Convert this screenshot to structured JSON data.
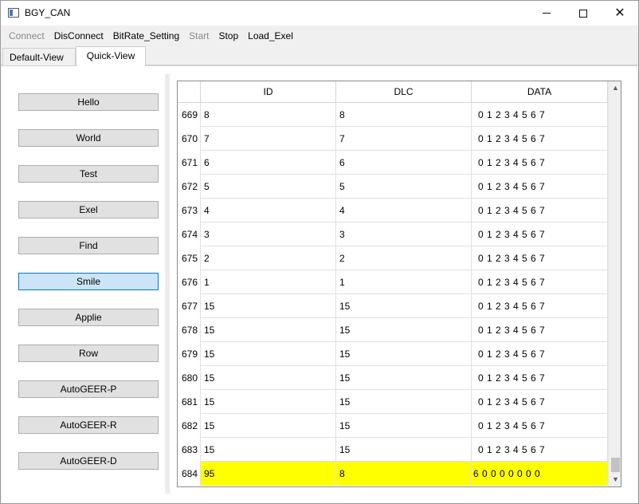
{
  "window": {
    "title": "BGY_CAN",
    "minimize_glyph": "",
    "maximize_glyph": "",
    "close_glyph": "✕"
  },
  "menu": [
    {
      "label": "Connect",
      "enabled": false
    },
    {
      "label": "DisConnect",
      "enabled": true
    },
    {
      "label": "BitRate_Setting",
      "enabled": true
    },
    {
      "label": "Start",
      "enabled": false
    },
    {
      "label": "Stop",
      "enabled": true
    },
    {
      "label": "Load_Exel",
      "enabled": true
    }
  ],
  "tabs": [
    {
      "label": "Default-View",
      "active": false
    },
    {
      "label": "Quick-View",
      "active": true
    }
  ],
  "quick_buttons": [
    {
      "label": "Hello"
    },
    {
      "label": "World"
    },
    {
      "label": "Test"
    },
    {
      "label": "Exel"
    },
    {
      "label": "Find"
    },
    {
      "label": "Smile",
      "focused": true
    },
    {
      "label": "Applie"
    },
    {
      "label": "Row"
    },
    {
      "label": "AutoGEER-P"
    },
    {
      "label": "AutoGEER-R"
    },
    {
      "label": "AutoGEER-D"
    }
  ],
  "table": {
    "headers": {
      "id": "ID",
      "dlc": "DLC",
      "data": "DATA"
    },
    "rows": [
      {
        "num": "669",
        "id": "8",
        "dlc": "8",
        "data": "0 1 2 3 4 5 6 7"
      },
      {
        "num": "670",
        "id": "7",
        "dlc": "7",
        "data": "0 1 2 3 4 5 6 7"
      },
      {
        "num": "671",
        "id": "6",
        "dlc": "6",
        "data": "0 1 2 3 4 5 6 7"
      },
      {
        "num": "672",
        "id": "5",
        "dlc": "5",
        "data": "0 1 2 3 4 5 6 7"
      },
      {
        "num": "673",
        "id": "4",
        "dlc": "4",
        "data": "0 1 2 3 4 5 6 7"
      },
      {
        "num": "674",
        "id": "3",
        "dlc": "3",
        "data": "0 1 2 3 4 5 6 7"
      },
      {
        "num": "675",
        "id": "2",
        "dlc": "2",
        "data": "0 1 2 3 4 5 6 7"
      },
      {
        "num": "676",
        "id": "1",
        "dlc": "1",
        "data": "0 1 2 3 4 5 6 7"
      },
      {
        "num": "677",
        "id": "15",
        "dlc": "15",
        "data": "0 1 2 3 4 5 6 7"
      },
      {
        "num": "678",
        "id": "15",
        "dlc": "15",
        "data": "0 1 2 3 4 5 6 7"
      },
      {
        "num": "679",
        "id": "15",
        "dlc": "15",
        "data": "0 1 2 3 4 5 6 7"
      },
      {
        "num": "680",
        "id": "15",
        "dlc": "15",
        "data": "0 1 2 3 4 5 6 7"
      },
      {
        "num": "681",
        "id": "15",
        "dlc": "15",
        "data": "0 1 2 3 4 5 6 7"
      },
      {
        "num": "682",
        "id": "15",
        "dlc": "15",
        "data": "0 1 2 3 4 5 6 7"
      },
      {
        "num": "683",
        "id": "15",
        "dlc": "15",
        "data": "0 1 2 3 4 5 6 7"
      },
      {
        "num": "684",
        "id": "95",
        "dlc": "8",
        "data": "6 0 0 0 0 0 0 0",
        "highlight": true
      }
    ],
    "highlight_color": "#ffff00"
  },
  "scrollbar": {
    "up_glyph": "▲",
    "down_glyph": "▼"
  }
}
